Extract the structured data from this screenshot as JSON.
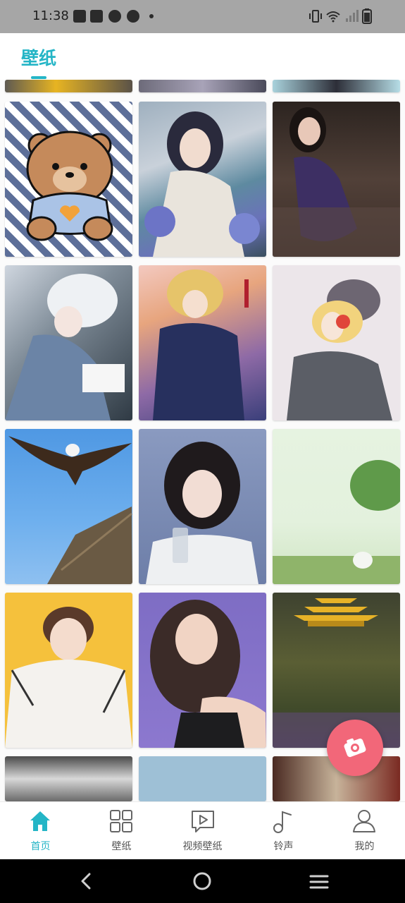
{
  "status_bar": {
    "time": "11:38"
  },
  "header": {
    "title": "壁纸"
  },
  "wallpapers": [
    "teddy bear on houndstooth pattern",
    "anime girl with umbrella and hydrangeas",
    "woman in purple dress",
    "white-haired anime girl",
    "anime girl with blonde hair in dark coat",
    "anime girl with headphones",
    "eagle over nest",
    "woman with glass",
    "pastel landscape with cloud",
    "young man in white hoodie",
    "smiling woman on purple background",
    "golden pagoda above meadow"
  ],
  "bottom_nav": {
    "items": [
      {
        "label": "首页",
        "icon": "home-icon",
        "active": true
      },
      {
        "label": "壁纸",
        "icon": "grid-icon",
        "active": false
      },
      {
        "label": "视频壁纸",
        "icon": "video-icon",
        "active": false
      },
      {
        "label": "铃声",
        "icon": "music-note-icon",
        "active": false
      },
      {
        "label": "我的",
        "icon": "person-icon",
        "active": false
      }
    ]
  },
  "colors": {
    "accent": "#24b5c6",
    "fab": "#f26779"
  }
}
